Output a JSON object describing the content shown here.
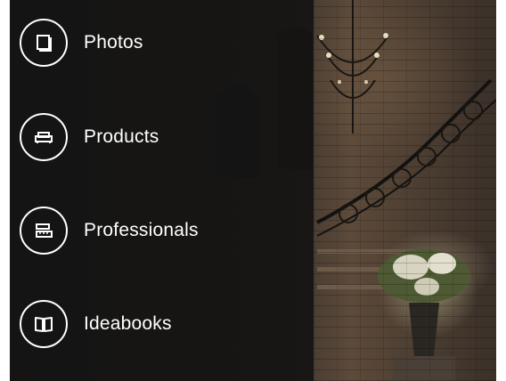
{
  "menu": {
    "items": [
      {
        "label": "Photos",
        "icon": "photos-icon"
      },
      {
        "label": "Products",
        "icon": "sofa-icon"
      },
      {
        "label": "Professionals",
        "icon": "ruler-icon"
      },
      {
        "label": "Ideabooks",
        "icon": "book-icon"
      }
    ]
  },
  "colors": {
    "drawer_background": "#121212",
    "icon_outline": "#ffffff",
    "label_text": "#ffffff"
  }
}
